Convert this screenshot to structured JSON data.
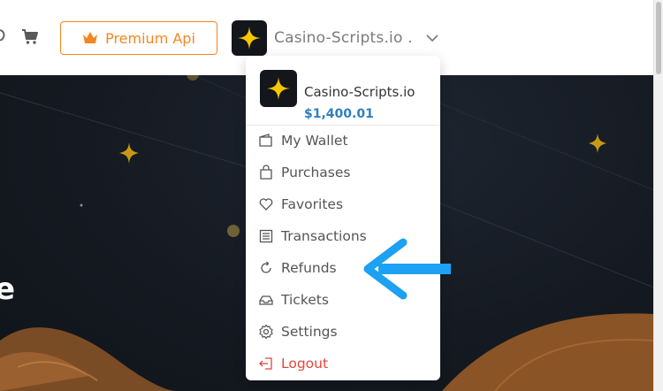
{
  "header": {
    "premium_label": "Premium Api",
    "user_display": "Casino-Scripts.io ."
  },
  "dropdown": {
    "user_name": "Casino-Scripts.io",
    "balance": "$1,400.01",
    "items": [
      {
        "label": "My Wallet",
        "icon": "wallet-icon"
      },
      {
        "label": "Purchases",
        "icon": "shopping-bag-icon"
      },
      {
        "label": "Favorites",
        "icon": "heart-icon"
      },
      {
        "label": "Transactions",
        "icon": "list-icon"
      },
      {
        "label": "Refunds",
        "icon": "refund-icon"
      },
      {
        "label": "Tickets",
        "icon": "ticket-icon"
      },
      {
        "label": "Settings",
        "icon": "gear-icon"
      },
      {
        "label": "Logout",
        "icon": "logout-icon"
      }
    ]
  },
  "hero": {
    "partial_text": "e"
  },
  "colors": {
    "accent_orange": "#f5871f",
    "balance_blue": "#2f7fc0",
    "logout_red": "#e4443a",
    "annotation_arrow": "#1da1f2",
    "hero_bg": "#151a22"
  }
}
